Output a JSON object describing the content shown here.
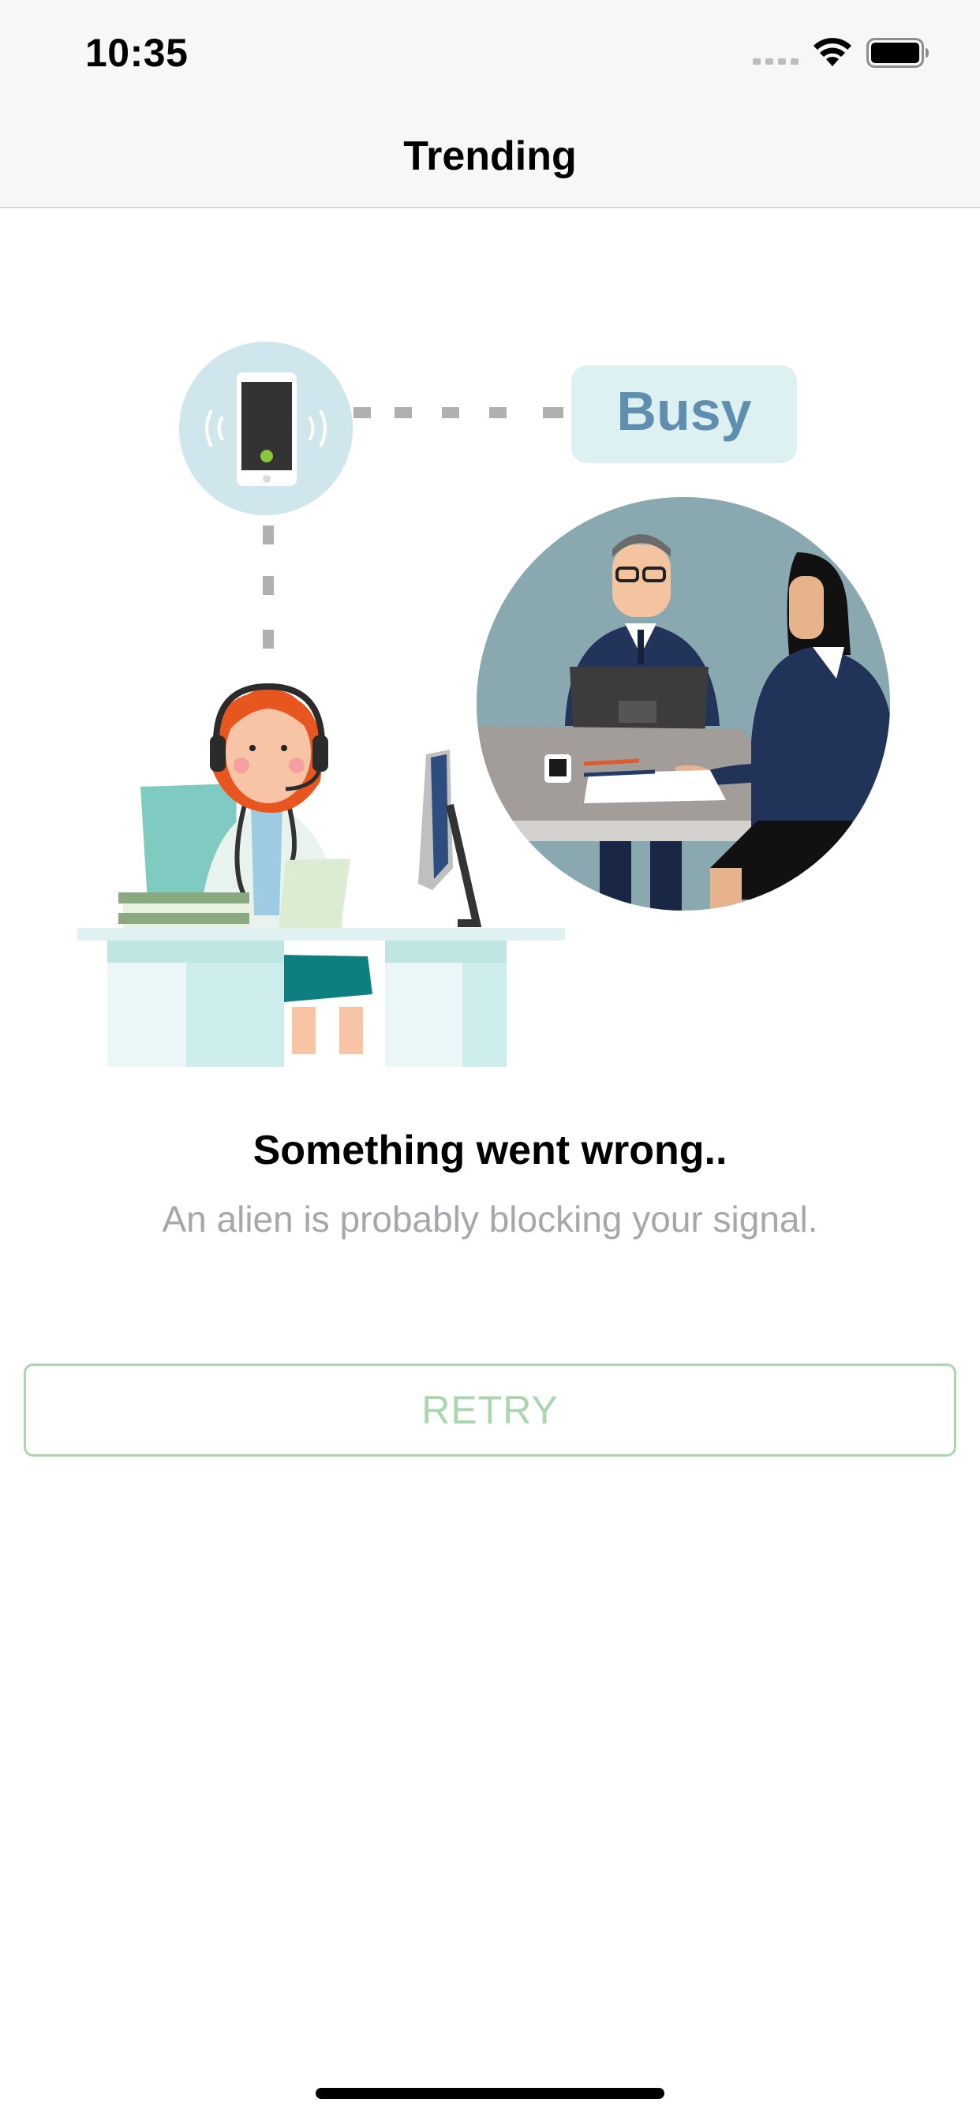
{
  "status_bar": {
    "time": "10:35",
    "icons": [
      "signal-dots-icon",
      "wifi-icon",
      "battery-icon"
    ]
  },
  "nav": {
    "title": "Trending"
  },
  "illustration": {
    "busy_label": "Busy",
    "description_icons": [
      "phone-icon",
      "operator-icon",
      "desk-icon",
      "monitor-icon",
      "meeting-icon"
    ]
  },
  "message": {
    "title": "Something went wrong..",
    "subtitle": "An alien is probably blocking your signal."
  },
  "retry": {
    "label": "RETRY"
  },
  "colors": {
    "accent": "#a9d6ac",
    "subtitle_gray": "#a6a6ac",
    "bar_background": "#f7f7f7",
    "illustration_teal": "#cfe6ec"
  }
}
